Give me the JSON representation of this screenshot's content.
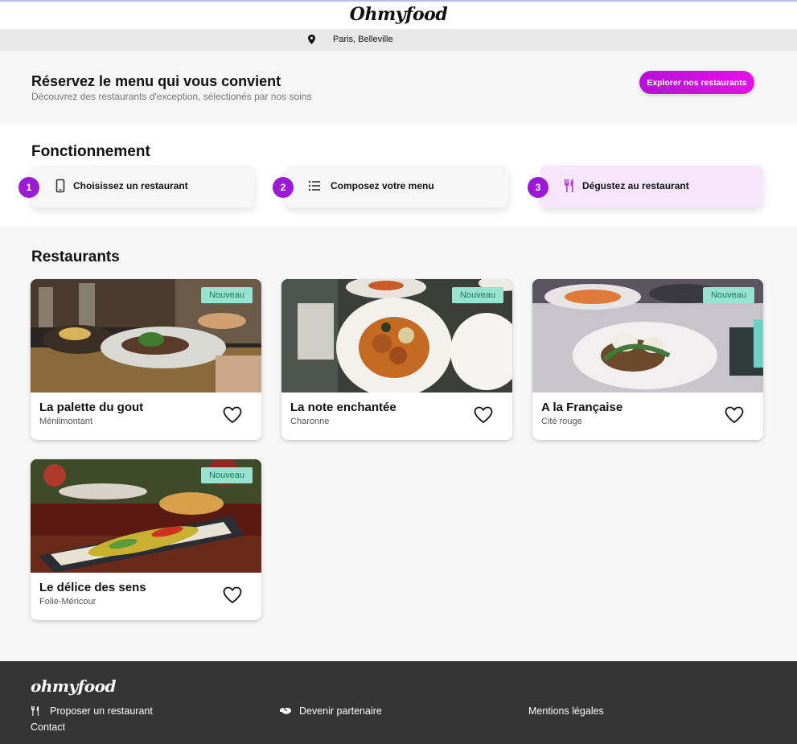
{
  "header": {
    "logo": "Ohmyfood",
    "location": "Paris, Belleville",
    "location_icon": "map-pin-icon"
  },
  "hero": {
    "title": "Réservez le menu qui vous convient",
    "subtitle": "Découvrez des restaurants d'exception, sélectionés par nos soins",
    "cta_label": "Explorer nos restaurants"
  },
  "how": {
    "title": "Fonctionnement",
    "steps": [
      {
        "number": "1",
        "label": "Choisissez un restaurant",
        "icon": "phone-icon"
      },
      {
        "number": "2",
        "label": "Composez votre menu",
        "icon": "list-icon"
      },
      {
        "number": "3",
        "label": "Dégustez au restaurant",
        "icon": "utensils-icon"
      }
    ]
  },
  "restaurants": {
    "title": "Restaurants",
    "badge": "Nouveau",
    "items": [
      {
        "name": "La palette du gout",
        "location": "Ménilmontant"
      },
      {
        "name": "La note enchantée",
        "location": "Charonne"
      },
      {
        "name": "A la Française",
        "location": "Cité rouge"
      },
      {
        "name": "Le délice des sens",
        "location": "Folie-Méricour"
      }
    ]
  },
  "footer": {
    "logo": "ohmyfood",
    "links": [
      {
        "label": "Proposer un restaurant",
        "icon": "utensils-icon"
      },
      {
        "label": "Devenir partenaire",
        "icon": "handshake-icon"
      },
      {
        "label": "Mentions légales"
      },
      {
        "label": "Contact"
      }
    ]
  },
  "colors": {
    "accent": "#9c1ad6",
    "button_gradient_start": "#b80fd8",
    "badge_bg": "#99e2d0",
    "footer_bg": "#353535"
  }
}
